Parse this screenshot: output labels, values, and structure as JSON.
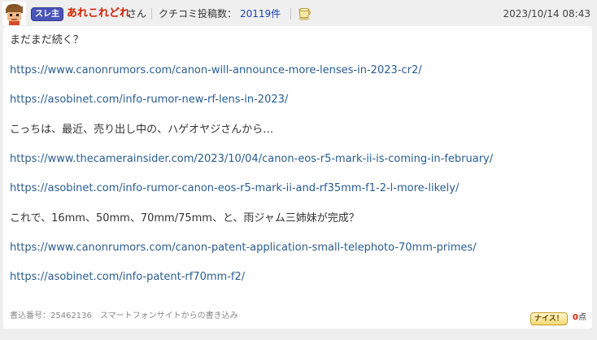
{
  "header": {
    "badge": "スレ主",
    "user_name": "あれこれどれ",
    "user_suffix": "さん",
    "posts_label": "クチコミ投稿数：",
    "posts_count": "20119件",
    "datetime": "2023/10/14 08:43"
  },
  "post": {
    "lines": [
      {
        "type": "text",
        "value": "まだまだ続く？"
      },
      {
        "type": "link",
        "value": "https://www.canonrumors.com/canon-will-announce-more-lenses-in-2023-cr2/"
      },
      {
        "type": "link",
        "value": "https://asobinet.com/info-rumor-new-rf-lens-in-2023/"
      },
      {
        "type": "text",
        "value": "こっちは、最近、売り出し中の、ハゲオヤジさんから…"
      },
      {
        "type": "link",
        "value": "https://www.thecamerainsider.com/2023/10/04/canon-eos-r5-mark-ii-is-coming-in-february/"
      },
      {
        "type": "link",
        "value": "https://asobinet.com/info-rumor-canon-eos-r5-mark-ii-and-rf35mm-f1-2-l-more-likely/"
      },
      {
        "type": "text",
        "value": "これで、16mm、50mm、70mm/75mm、と、雨ジャム三姉妹が完成？"
      },
      {
        "type": "link",
        "value": "https://www.canonrumors.com/canon-patent-application-small-telephoto-70mm-primes/"
      },
      {
        "type": "link",
        "value": "https://asobinet.com/info-patent-rf70mm-f2/"
      }
    ]
  },
  "footer": {
    "post_number": "書込番号：25462136",
    "source": "スマートフォンサイトからの書き込み",
    "nice_label": "ナイス！",
    "points_value": "0",
    "points_unit": "点"
  },
  "colors": {
    "link": "#2a5d8f",
    "username": "#cc2200",
    "badge": "#4a55b8",
    "post_count": "#1a3fb5",
    "background": "#efefef"
  },
  "icons": {
    "avatar": "avatar-icon",
    "rank": "cup-icon"
  }
}
